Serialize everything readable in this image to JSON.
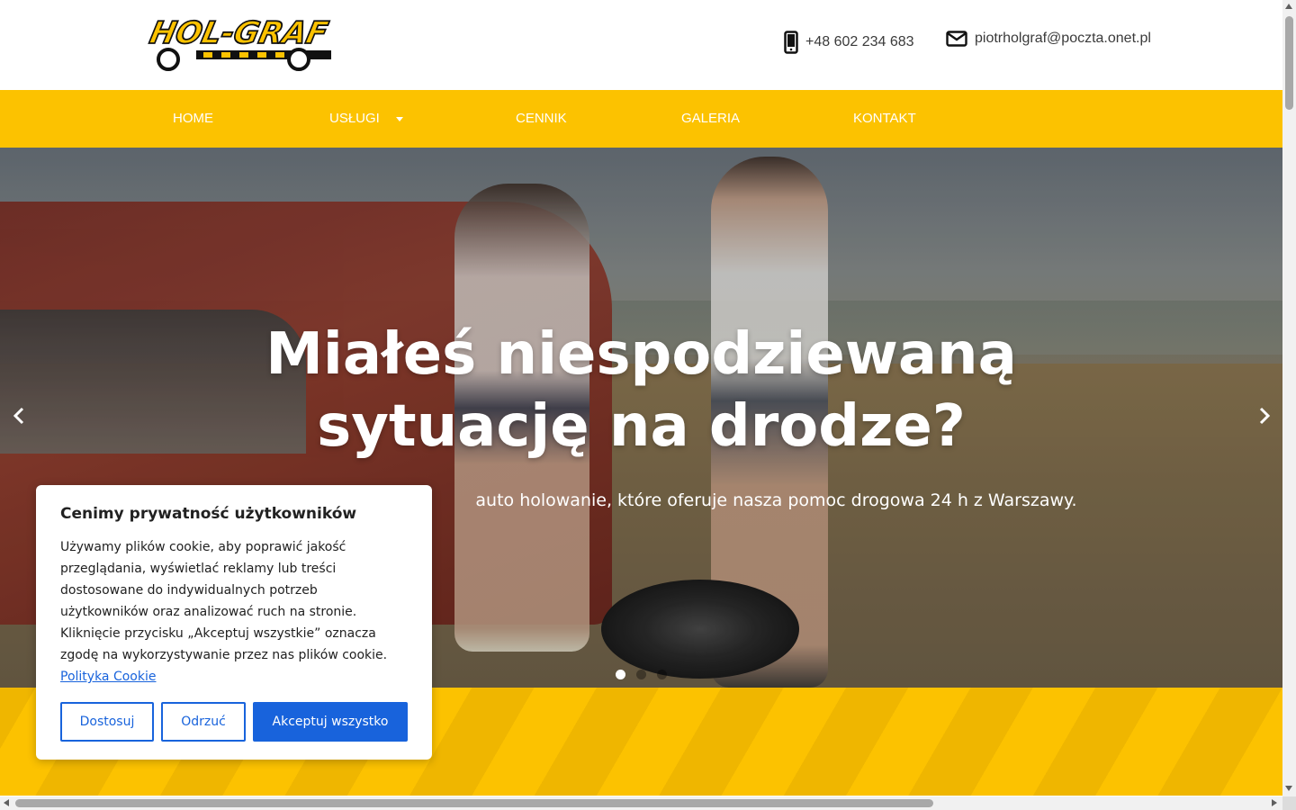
{
  "header": {
    "logo_text": "HOL-GRAF",
    "phone": "+48 602 234 683",
    "email": "piotrholgraf@poczta.onet.pl"
  },
  "nav": {
    "items": [
      {
        "label": "HOME"
      },
      {
        "label": "USŁUGI",
        "has_dropdown": true
      },
      {
        "label": "CENNIK"
      },
      {
        "label": "GALERIA"
      },
      {
        "label": "KONTAKT"
      }
    ]
  },
  "hero": {
    "title_line1": "Miałeś niespodziewaną",
    "title_line2": "sytuację na drodze?",
    "subtitle": "auto holowanie, które oferuje nasza pomoc drogowa 24 h z Warszawy.",
    "slide_count": 3,
    "active_slide": 1
  },
  "cookie": {
    "title": "Cenimy prywatność użytkowników",
    "text": "Używamy plików cookie, aby poprawić jakość przeglądania, wyświetlać reklamy lub treści dostosowane do indywidualnych potrzeb użytkowników oraz analizować ruch na stronie. Kliknięcie przycisku „Akceptuj wszystkie” oznacza zgodę na wykorzystywanie przez nas plików cookie.",
    "policy_link": "Polityka Cookie",
    "btn_customize": "Dostosuj",
    "btn_reject": "Odrzuć",
    "btn_accept": "Akceptuj wszystko"
  },
  "colors": {
    "brand_yellow": "#fcc200",
    "accent_blue": "#1863dc",
    "text_dark": "#212121"
  }
}
